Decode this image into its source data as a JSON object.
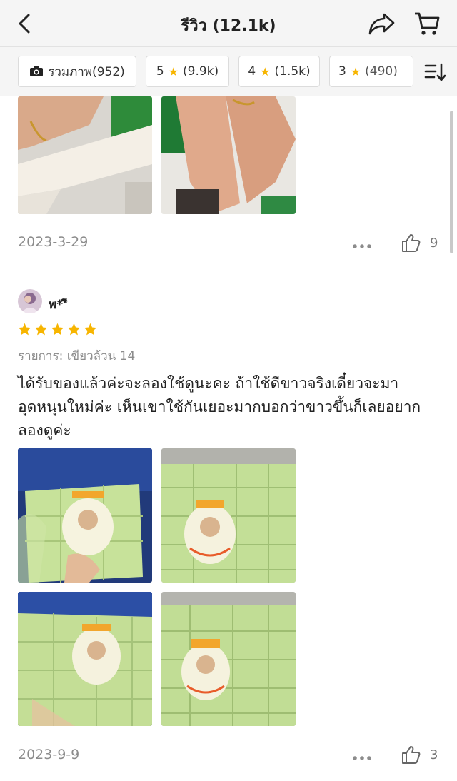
{
  "header": {
    "title": "รีวิว (12.1k)"
  },
  "filters": [
    {
      "label": "รวมภาพ(952)",
      "icon": "camera-icon"
    },
    {
      "label": "5",
      "count": "(9.9k)",
      "icon": "star-icon"
    },
    {
      "label": "4",
      "count": "(1.5k)",
      "icon": "star-icon"
    },
    {
      "label": "3",
      "count": "(490)",
      "icon": "star-icon"
    }
  ],
  "review1": {
    "date": "2023-3-29",
    "likes": "9"
  },
  "review2": {
    "username": "พ**ี",
    "rating": 5,
    "variant": "รายการ: เขียวล้วน 14",
    "text": "ได้รับของแล้วค่ะจะลองใช้ดูนะคะ ถ้าใช้ดีขาวจริงเดี๋ยวจะมาอุดหนุนใหม่ค่ะ เห็นเขาใช้กันเยอะมากบอกว่าขาวขึ้นก็เลยอยากลองดูค่ะ",
    "date": "2023-9-9",
    "likes": "3"
  },
  "colors": {
    "accent_star": "#f7b500",
    "soap_green": "#b8d98a"
  }
}
